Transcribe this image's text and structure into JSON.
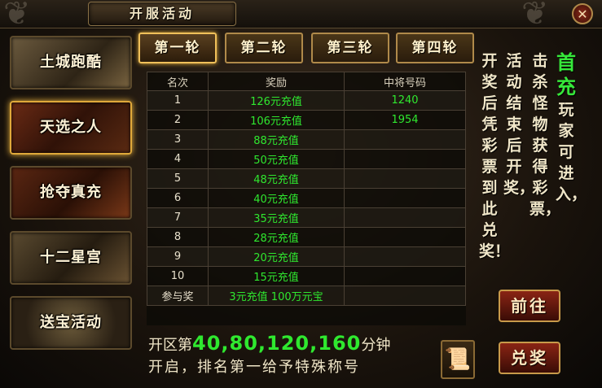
{
  "window": {
    "title": "开服活动",
    "close_glyph": "✕"
  },
  "sidebar": {
    "items": [
      {
        "label": "土城跑酷",
        "active": false
      },
      {
        "label": "天选之人",
        "active": true
      },
      {
        "label": "抢夺真充",
        "active": false
      },
      {
        "label": "十二星宫",
        "active": false
      },
      {
        "label": "送宝活动",
        "active": false
      }
    ]
  },
  "tabs": [
    {
      "label": "第一轮",
      "active": true
    },
    {
      "label": "第二轮",
      "active": false
    },
    {
      "label": "第三轮",
      "active": false
    },
    {
      "label": "第四轮",
      "active": false
    }
  ],
  "table": {
    "headers": [
      "名次",
      "奖励",
      "中将号码"
    ],
    "rows": [
      [
        "1",
        "126元充值",
        "1240"
      ],
      [
        "2",
        "106元充值",
        "1954"
      ],
      [
        "3",
        "88元充值",
        ""
      ],
      [
        "4",
        "50元充值",
        ""
      ],
      [
        "5",
        "48元充值",
        ""
      ],
      [
        "6",
        "40元充值",
        ""
      ],
      [
        "7",
        "35元充值",
        ""
      ],
      [
        "8",
        "28元充值",
        ""
      ],
      [
        "9",
        "20元充值",
        ""
      ],
      [
        "10",
        "15元充值",
        ""
      ],
      [
        "参与奖",
        "3元充值 100万元宝",
        ""
      ]
    ]
  },
  "info": {
    "col1_highlight": "首充",
    "col1_text": "玩家可进入，",
    "col2_text": "击杀怪物获得彩票，",
    "col3_text": "活动结束后开奖，",
    "col4_text": "开奖后凭彩票到此兑奖！"
  },
  "buttons": {
    "goto": "前往",
    "redeem": "兑奖"
  },
  "footer": {
    "line1_prefix": "开区第",
    "line1_numbers": "40,80,120,160",
    "line1_suffix": "分钟",
    "line2": "开启，排名第一给予特殊称号"
  },
  "colors": {
    "accent_green": "#2fe82f",
    "gold_border": "#f0c05a",
    "button_red": "#8a2414"
  },
  "icons": {
    "close": "close-icon",
    "scroll": "scroll-icon"
  }
}
